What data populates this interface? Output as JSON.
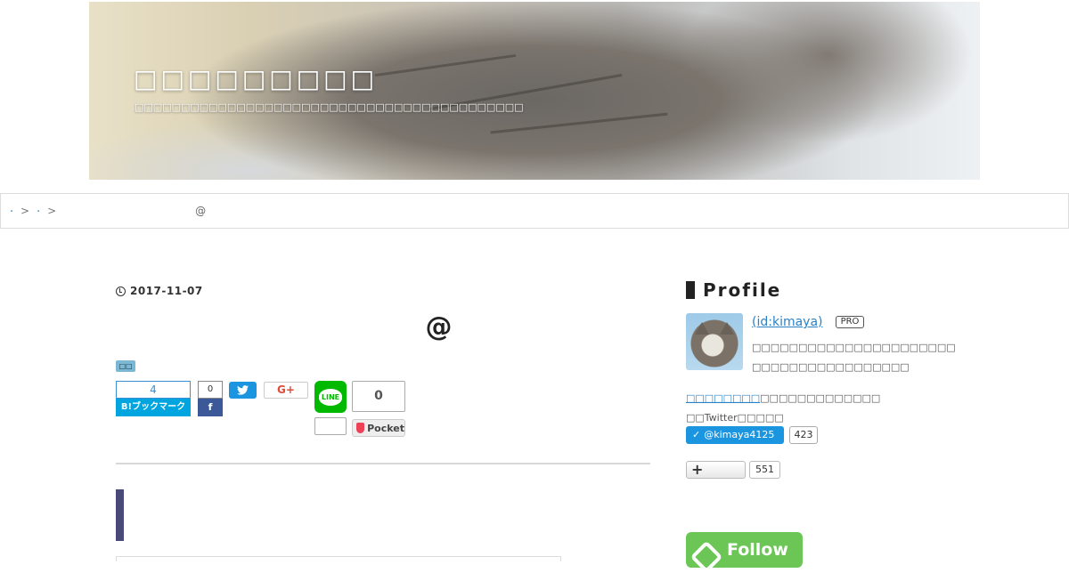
{
  "header": {
    "title": "□□□□□□□□□",
    "description": "□□□□□□□□□□□□□□□□□□□□□□□□□□□□□□□□□□□□□□□□□□"
  },
  "breadcrumb": {
    "home_label": "・",
    "category_label": "・",
    "separator": ">",
    "current": "@"
  },
  "article": {
    "date": "2017-11-07",
    "title": "@",
    "category_tag": "□□"
  },
  "share": {
    "hatena_count": "4",
    "hatena_label": "B!ブックマーク",
    "facebook_count": "0",
    "facebook_icon": "f",
    "twitter_icon": "twitter-bird-icon",
    "google_plus_label": "G+",
    "line_label": "LINE",
    "line_count": "",
    "pocket_count": "0",
    "pocket_label": "Pocket"
  },
  "sidebar": {
    "profile_heading": "Profile",
    "profile_id": "(id:kimaya)",
    "pro_badge": "PRO",
    "profile_description": "□□□□□□□□□□□□□□□□□□□□□□□□□□□□□□□□□□□□□□□",
    "profile_link_text": "□□□□□□□□",
    "profile_line1_rest": "□□□□□□□□□□□□□",
    "profile_line2": "□□Twitter□□□□□",
    "twitter_follow_label": "@kimaya4125",
    "twitter_follow_count": "423",
    "reader_button_label": "+",
    "reader_count": "551",
    "feedly_label": "Follow"
  },
  "colors": {
    "accent_blue": "#2a82c6",
    "twitter_blue": "#1b95e0",
    "hatena_blue": "#00a4de",
    "facebook_blue": "#3b5998",
    "line_green": "#00b900",
    "feedly_green": "#6cc655",
    "heading_bar": "#4a4a7a"
  }
}
